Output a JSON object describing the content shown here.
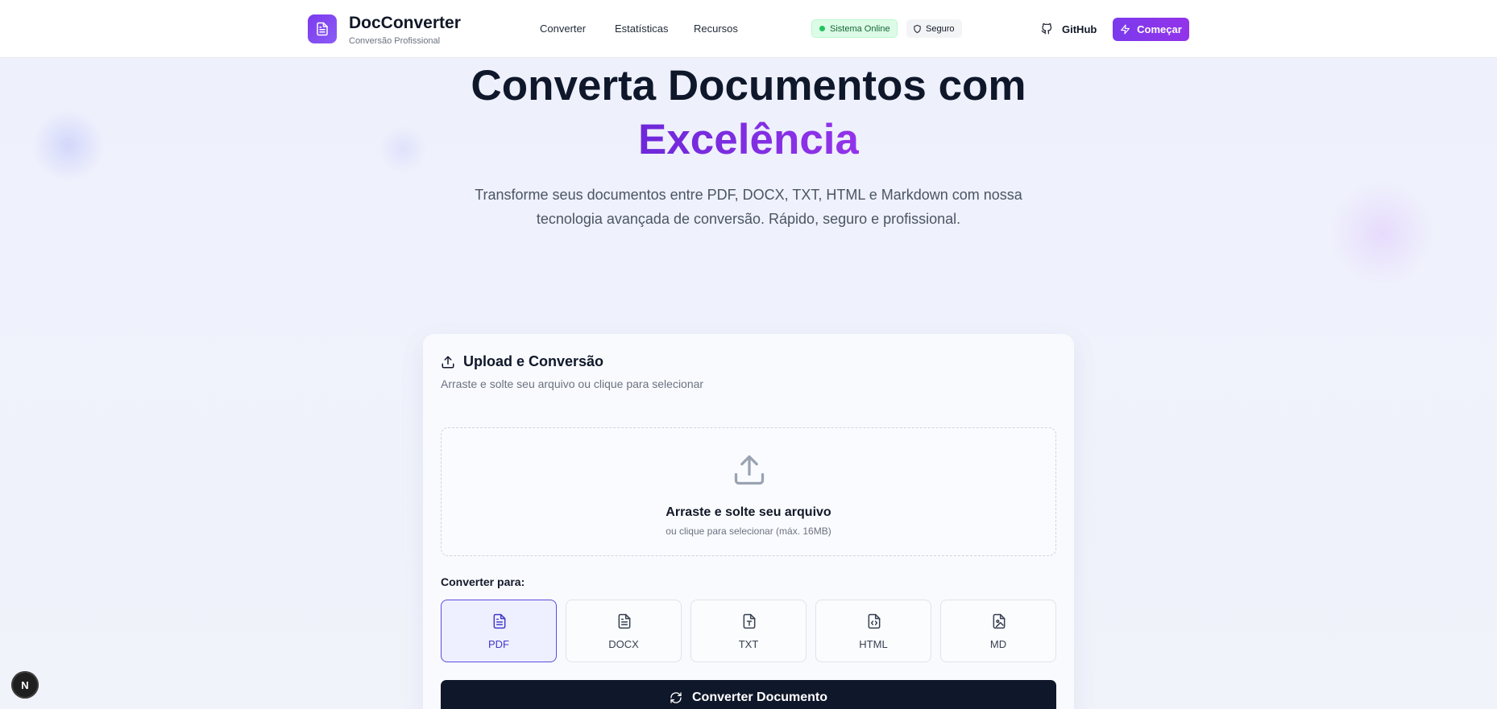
{
  "header": {
    "brand_name": "DocConverter",
    "brand_sub": "Conversão Profissional",
    "nav": [
      "Converter",
      "Estatísticas",
      "Recursos"
    ],
    "status_online": "Sistema Online",
    "status_secure": "Seguro",
    "github_label": "GitHub",
    "start_label": "Começar"
  },
  "hero": {
    "title_line1": "Converta Documentos com",
    "title_accent": "Excelência",
    "subtitle": "Transforme seus documentos entre PDF, DOCX, TXT, HTML e Markdown com nossa tecnologia avançada de conversão. Rápido, seguro e profissional."
  },
  "card": {
    "title": "Upload e Conversão",
    "subtitle": "Arraste e solte seu arquivo ou clique para selecionar",
    "drop_title": "Arraste e solte seu arquivo",
    "drop_sub": "ou clique para selecionar (máx. 16MB)",
    "convert_label": "Converter para:",
    "formats": [
      "PDF",
      "DOCX",
      "TXT",
      "HTML",
      "MD"
    ],
    "selected_format": "PDF",
    "convert_button": "Converter Documento"
  },
  "dev_badge": "N",
  "colors": {
    "accent": "#7c3aed",
    "online": "#22c55e",
    "dark_button": "#0f172a"
  }
}
